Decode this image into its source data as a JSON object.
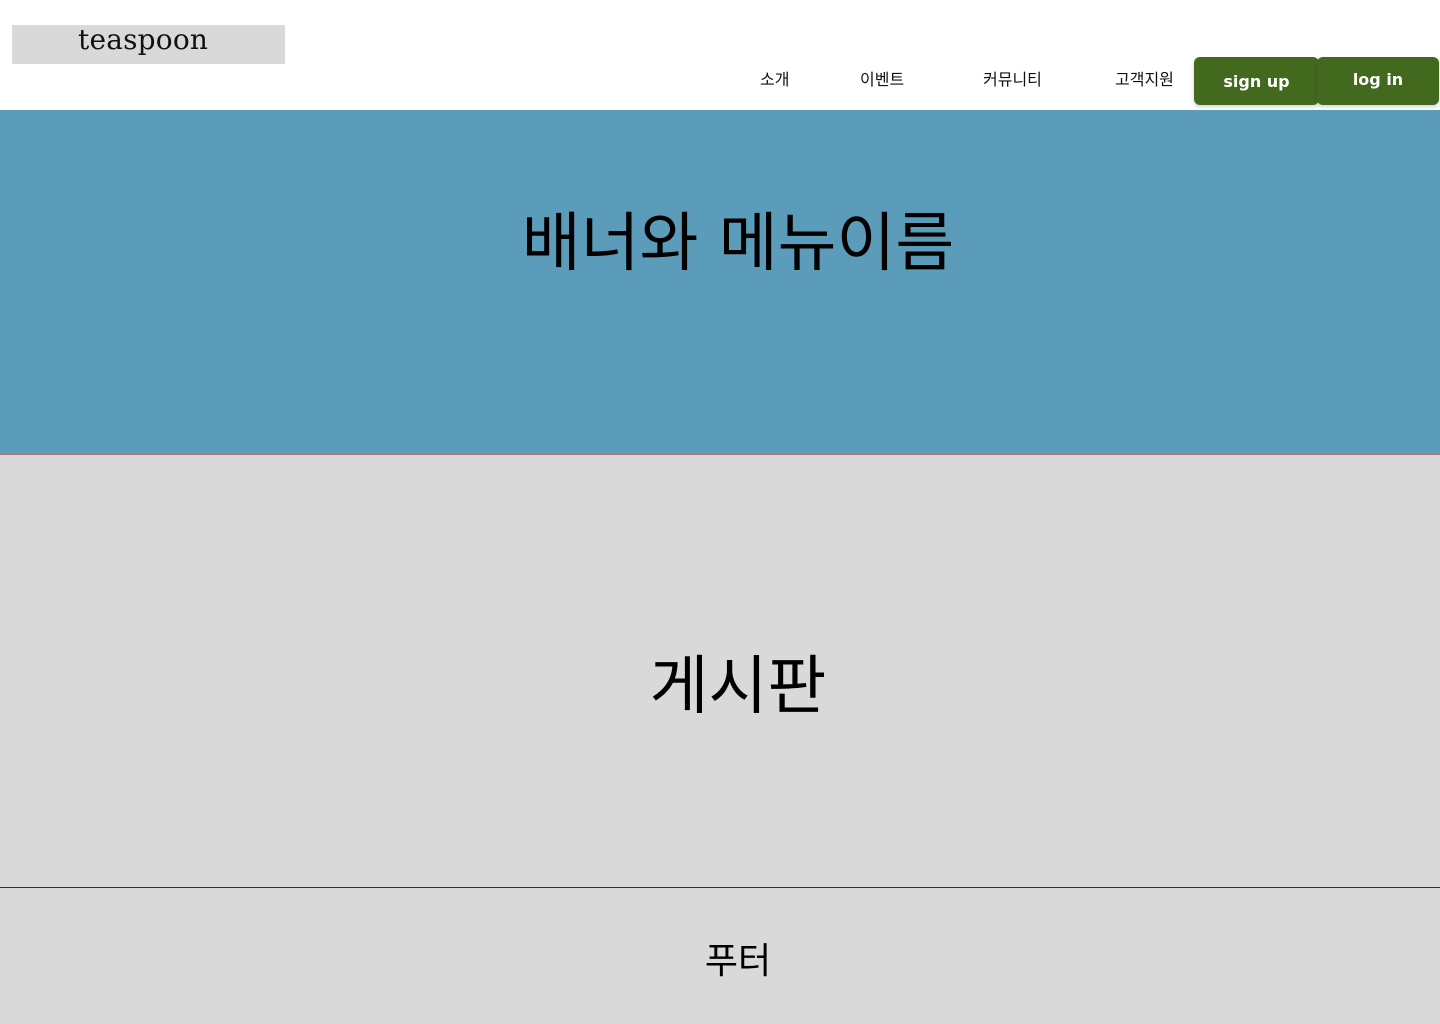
{
  "header": {
    "logo": "teaspoon",
    "nav": [
      "소개",
      "이벤트",
      "커뮤니티",
      "고객지원"
    ],
    "signup_label": "sign up",
    "login_label": "log in"
  },
  "banner": {
    "title": "배너와 메뉴이름"
  },
  "board": {
    "title": "게시판"
  },
  "footer": {
    "title": "푸터"
  },
  "colors": {
    "banner_bg": "#5b9cba",
    "section_bg": "#d9d9d9",
    "button_bg": "#43691f",
    "button_text": "#ffffff"
  }
}
